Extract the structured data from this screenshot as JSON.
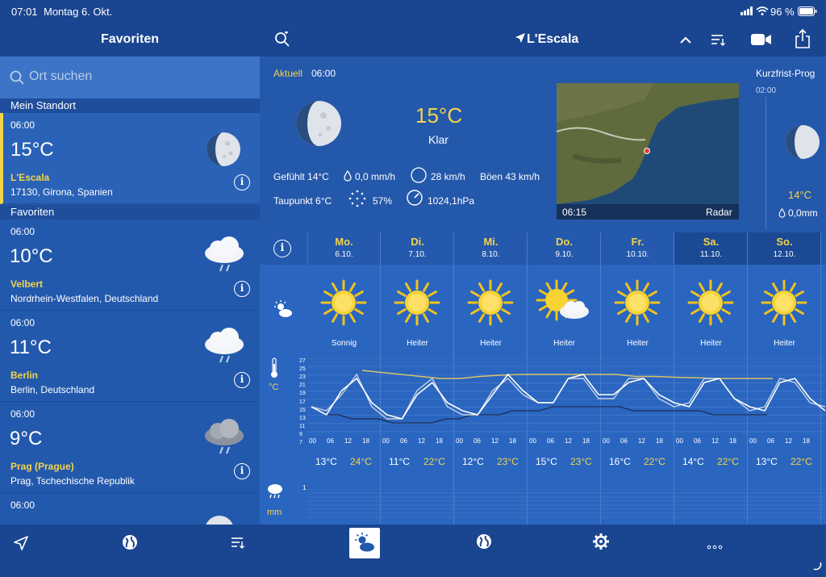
{
  "status": {
    "time": "07:01",
    "date": "Montag 6. Okt.",
    "battery": "96 %"
  },
  "left": {
    "title": "Favoriten",
    "search_placeholder": "Ort suchen",
    "my_location_header": "Mein Standort",
    "favorites_header": "Favoriten",
    "current_location": {
      "time": "06:00",
      "temp": "15°C",
      "name": "L'Escala",
      "sub": "17130, Girona, Spanien",
      "icon": "moon-icon"
    },
    "favorites": [
      {
        "time": "06:00",
        "temp": "10°C",
        "name": "Velbert",
        "sub": "Nordrhein-Westfalen, Deutschland",
        "icon": "rain-cloud-icon"
      },
      {
        "time": "06:00",
        "temp": "11°C",
        "name": "Berlin",
        "sub": "Berlin, Deutschland",
        "icon": "rain-cloud-icon"
      },
      {
        "time": "06:00",
        "temp": "9°C",
        "name": "Prag (Prague)",
        "sub": "Prag, Tschechische Republik",
        "icon": "dark-rain-cloud-icon"
      },
      {
        "time": "06:00",
        "temp": "",
        "name": "",
        "sub": "",
        "icon": "moon-icon"
      }
    ],
    "info_glyph": "i"
  },
  "right": {
    "title": "L'Escala",
    "current": {
      "label": "Aktuell",
      "time": "06:00",
      "temp": "15°C",
      "condition": "Klar",
      "feels": "Gefühlt 14°C",
      "precip": "0,0 mm/h",
      "wind": "28 km/h",
      "gusts": "Böen 43 km/h",
      "dewpoint": "Taupunkt 6°C",
      "humidity": "57%",
      "pressure": "1024,1hPa",
      "radar_time": "06:15",
      "radar_label": "Radar",
      "short_title": "Kurzfrist-Prog",
      "short_time": "02:00",
      "short_temp": "14°C",
      "short_precip": "0,0mm"
    },
    "unit_temp": "°C",
    "unit_precip": "mm",
    "precip_tick": "1",
    "days": [
      {
        "name": "Mo.",
        "date": "6.10.",
        "cond": "Sonnig",
        "min": "13°C",
        "max": "24°C",
        "icon": "sun-icon"
      },
      {
        "name": "Di.",
        "date": "7.10.",
        "cond": "Heiter",
        "min": "11°C",
        "max": "22°C",
        "icon": "sun-icon"
      },
      {
        "name": "Mi.",
        "date": "8.10.",
        "cond": "Heiter",
        "min": "12°C",
        "max": "23°C",
        "icon": "sun-icon"
      },
      {
        "name": "Do.",
        "date": "9.10.",
        "cond": "Heiter",
        "min": "15°C",
        "max": "23°C",
        "icon": "sun-cloud-icon"
      },
      {
        "name": "Fr.",
        "date": "10.10.",
        "cond": "Heiter",
        "min": "16°C",
        "max": "22°C",
        "icon": "sun-icon"
      },
      {
        "name": "Sa.",
        "date": "11.10.",
        "cond": "Heiter",
        "min": "14°C",
        "max": "22°C",
        "icon": "sun-icon"
      },
      {
        "name": "So.",
        "date": "12.10.",
        "cond": "Heiter",
        "min": "13°C",
        "max": "22°C",
        "icon": "sun-icon"
      }
    ],
    "hours": [
      "00",
      "06",
      "12",
      "18"
    ],
    "y_ticks": [
      "27",
      "25",
      "23",
      "21",
      "19",
      "17",
      "15",
      "13",
      "11",
      "9",
      "7"
    ],
    "temp_series": [
      15,
      13,
      19,
      22,
      16,
      13,
      12,
      18,
      21,
      16,
      14,
      13,
      18,
      23,
      19,
      16,
      16,
      22,
      23,
      18,
      18,
      21,
      22,
      18,
      16,
      15,
      21,
      22,
      17,
      15,
      14,
      21,
      22,
      17,
      14
    ],
    "feels_series": [
      15,
      14,
      18,
      23,
      15,
      12,
      12,
      19,
      22,
      15,
      13,
      13,
      19,
      22,
      18,
      16,
      16,
      22,
      22,
      17,
      17,
      22,
      22,
      17,
      15,
      16,
      22,
      22,
      17,
      14,
      15,
      22,
      21,
      16,
      15
    ],
    "dewpoint_series": [
      13,
      13,
      12,
      12,
      12,
      11,
      11,
      11,
      11,
      12,
      12,
      13,
      13,
      13,
      14,
      14,
      14,
      15,
      15,
      15,
      15,
      15,
      15,
      14,
      14,
      14,
      14,
      14,
      14,
      13,
      13,
      13,
      13,
      13
    ],
    "maxline_series": [
      24,
      23.5,
      23,
      22.5,
      22,
      22,
      22.5,
      22.8,
      23,
      23,
      23,
      23,
      23,
      23,
      22.5,
      22.5,
      22.3,
      22.2,
      22,
      22,
      22,
      22
    ],
    "colors": {
      "accent": "#f3d34a",
      "panel": "#245db2",
      "header": "#1a4590"
    }
  }
}
